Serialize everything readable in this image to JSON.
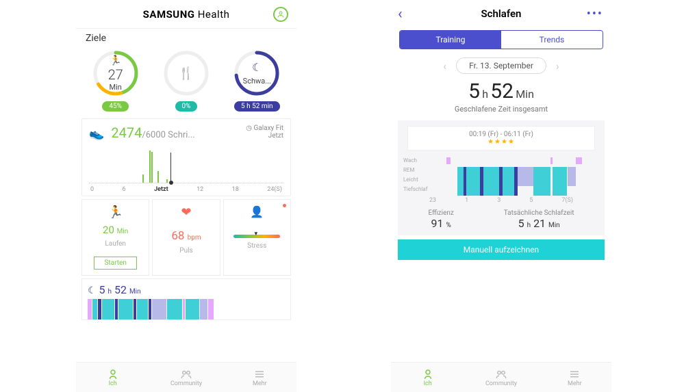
{
  "left": {
    "app_title_bold": "SAMSUNG",
    "app_title_light": " Health",
    "section_goals": "Ziele",
    "goal_activity": {
      "value": "27",
      "unit": "Min",
      "pill": "45%"
    },
    "goal_food": {
      "pill": "0%"
    },
    "goal_sleep": {
      "label": "Schwa...",
      "pill": "5 h  52 min"
    },
    "steps": {
      "value": "2474",
      "goal_suffix": "/6000 Schri...",
      "source_icon_label": "Galaxy Fit",
      "source_sub": "Jetzt",
      "now_label": "Jetzt"
    },
    "tiles": {
      "run": {
        "value": "20",
        "unit": "Min",
        "label": "Laufen",
        "button": "Starten"
      },
      "pulse": {
        "value": "68",
        "unit": "bpm",
        "label": "Puls"
      },
      "stress": {
        "label": "Stress"
      }
    },
    "sleep_row": {
      "hours": "5",
      "h_unit": "h",
      "mins": "52",
      "m_unit": "Min"
    },
    "nav": {
      "ich": "Ich",
      "community": "Community",
      "mehr": "Mehr"
    }
  },
  "right": {
    "title": "Schlafen",
    "tab_training": "Training",
    "tab_trends": "Trends",
    "date": "Fr. 13. September",
    "total": {
      "h": "5",
      "h_u": "h",
      "m": "52",
      "m_u": "Min"
    },
    "total_label": "Geschlafene Zeit insgesamt",
    "tooltip_range": "00:19 (Fr) - 06:11 (Fr)",
    "stars": "★★★★",
    "stage_labels": [
      "Wach",
      "REM",
      "Leicht",
      "Tiefschlaf"
    ],
    "xticks": [
      "23",
      "1",
      "3",
      "5",
      "7(S)"
    ],
    "efficiency_label": "Effizienz",
    "efficiency_value": "91",
    "efficiency_unit": "%",
    "actual_label": "Tatsächliche Schlafzeit",
    "actual_h": "5",
    "actual_h_u": "h",
    "actual_m": "21",
    "actual_m_u": "Min",
    "manual_btn": "Manuell aufzeichnen",
    "nav": {
      "ich": "Ich",
      "community": "Community",
      "mehr": "Mehr"
    }
  },
  "chart_data": {
    "steps_hourly": {
      "type": "bar",
      "x_range_hours": [
        0,
        24
      ],
      "now_hour": 9.5,
      "bars": [
        {
          "hour": 6.2,
          "height_rel": 0.25
        },
        {
          "hour": 7.0,
          "height_rel": 0.95
        },
        {
          "hour": 7.3,
          "height_rel": 0.9
        },
        {
          "hour": 8.0,
          "height_rel": 0.35
        },
        {
          "hour": 9.0,
          "height_rel": 0.1
        }
      ],
      "xticks": [
        "0",
        "6",
        "Jetzt",
        "12",
        "18",
        "24(S)"
      ]
    },
    "sleep_hypnogram": {
      "type": "hypnogram",
      "x_range_hours": [
        23,
        7
      ],
      "stages": [
        "Wach",
        "REM",
        "Leicht",
        "Tiefschlaf"
      ],
      "segments": [
        {
          "start": 23.8,
          "end": 24.0,
          "stage": "Wach",
          "color": "#e6a8ff"
        },
        {
          "start": 0.32,
          "end": 0.6,
          "stage": "Leicht",
          "color": "#3ed0d6"
        },
        {
          "start": 0.6,
          "end": 0.75,
          "stage": "Tiefschlaf",
          "color": "#3b3e9e"
        },
        {
          "start": 0.75,
          "end": 1.4,
          "stage": "Leicht",
          "color": "#3ed0d6"
        },
        {
          "start": 1.4,
          "end": 1.55,
          "stage": "Tiefschlaf",
          "color": "#3b3e9e"
        },
        {
          "start": 1.55,
          "end": 2.3,
          "stage": "Leicht",
          "color": "#3ed0d6"
        },
        {
          "start": 2.3,
          "end": 2.45,
          "stage": "Tiefschlaf",
          "color": "#3b3e9e"
        },
        {
          "start": 2.45,
          "end": 3.0,
          "stage": "Leicht",
          "color": "#3ed0d6"
        },
        {
          "start": 3.0,
          "end": 3.15,
          "stage": "Tiefschlaf",
          "color": "#3b3e9e"
        },
        {
          "start": 3.15,
          "end": 3.9,
          "stage": "REM",
          "color": "#b7b9e8"
        },
        {
          "start": 3.9,
          "end": 4.7,
          "stage": "Leicht",
          "color": "#3ed0d6"
        },
        {
          "start": 4.7,
          "end": 4.8,
          "stage": "Wach",
          "color": "#e6a8ff"
        },
        {
          "start": 4.8,
          "end": 5.5,
          "stage": "Leicht",
          "color": "#3ed0d6"
        },
        {
          "start": 5.5,
          "end": 5.9,
          "stage": "REM",
          "color": "#b7b9e8"
        },
        {
          "start": 5.9,
          "end": 6.18,
          "stage": "Wach",
          "color": "#e6a8ff"
        }
      ]
    }
  }
}
